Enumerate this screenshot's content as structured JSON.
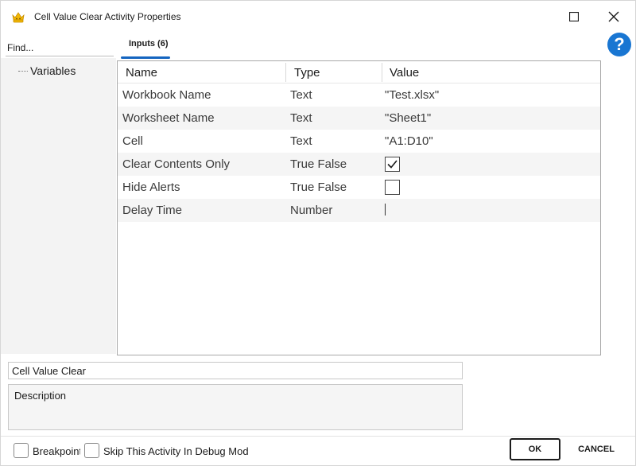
{
  "window": {
    "title": "Cell Value Clear Activity Properties",
    "app_icon": "robot-crown-icon",
    "accent_color": "#1976d2"
  },
  "left_panel": {
    "find_label": "Find...",
    "tree_items": [
      "Variables"
    ]
  },
  "tabs": [
    {
      "label": "Inputs (6)",
      "active": true
    }
  ],
  "grid": {
    "columns": [
      "Name",
      "Type",
      "Value"
    ],
    "rows": [
      {
        "name": "Workbook Name",
        "type": "Text",
        "value": "\"Test.xlsx\""
      },
      {
        "name": "Worksheet Name",
        "type": "Text",
        "value": "\"Sheet1\""
      },
      {
        "name": "Cell",
        "type": "Text",
        "value": "\"A1:D10\""
      },
      {
        "name": "Clear Contents Only",
        "type": "True False",
        "checked": true
      },
      {
        "name": "Hide Alerts",
        "type": "True False",
        "checked": false
      },
      {
        "name": "Delay Time",
        "type": "Number",
        "value": ""
      }
    ]
  },
  "activity": {
    "name": "Cell Value Clear",
    "description_label": "Description"
  },
  "footer": {
    "breakpoint_label": "Breakpoint",
    "skip_label": "Skip This Activity In Debug Mode",
    "ok_label": "OK",
    "cancel_label": "CANCEL"
  }
}
